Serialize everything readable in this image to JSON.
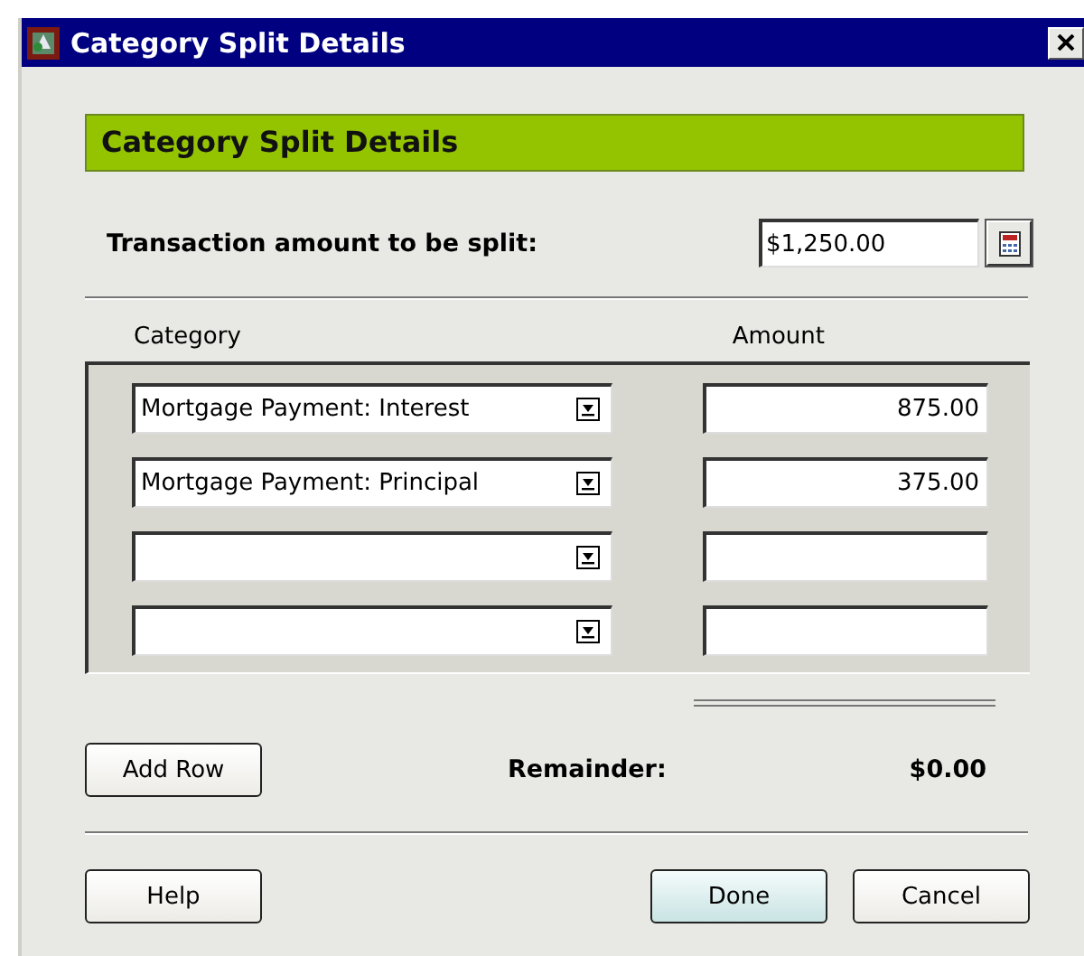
{
  "window": {
    "title": "Category Split Details"
  },
  "header": "Category Split Details",
  "transaction": {
    "label": "Transaction amount to be split:",
    "value": "$1,250.00"
  },
  "columns": [
    "Category",
    "Amount"
  ],
  "rows": [
    {
      "category": "Mortgage Payment: Interest",
      "amount": "875.00"
    },
    {
      "category": "Mortgage Payment: Principal",
      "amount": "375.00"
    },
    {},
    {}
  ],
  "add_row": "Add Row",
  "remainder": {
    "label": "Remainder:",
    "value": "$0.00"
  },
  "buttons": [
    {
      "label": "Help",
      "default": false
    },
    {
      "label": "Done",
      "default": true
    },
    {
      "label": "Cancel",
      "default": false
    }
  ]
}
